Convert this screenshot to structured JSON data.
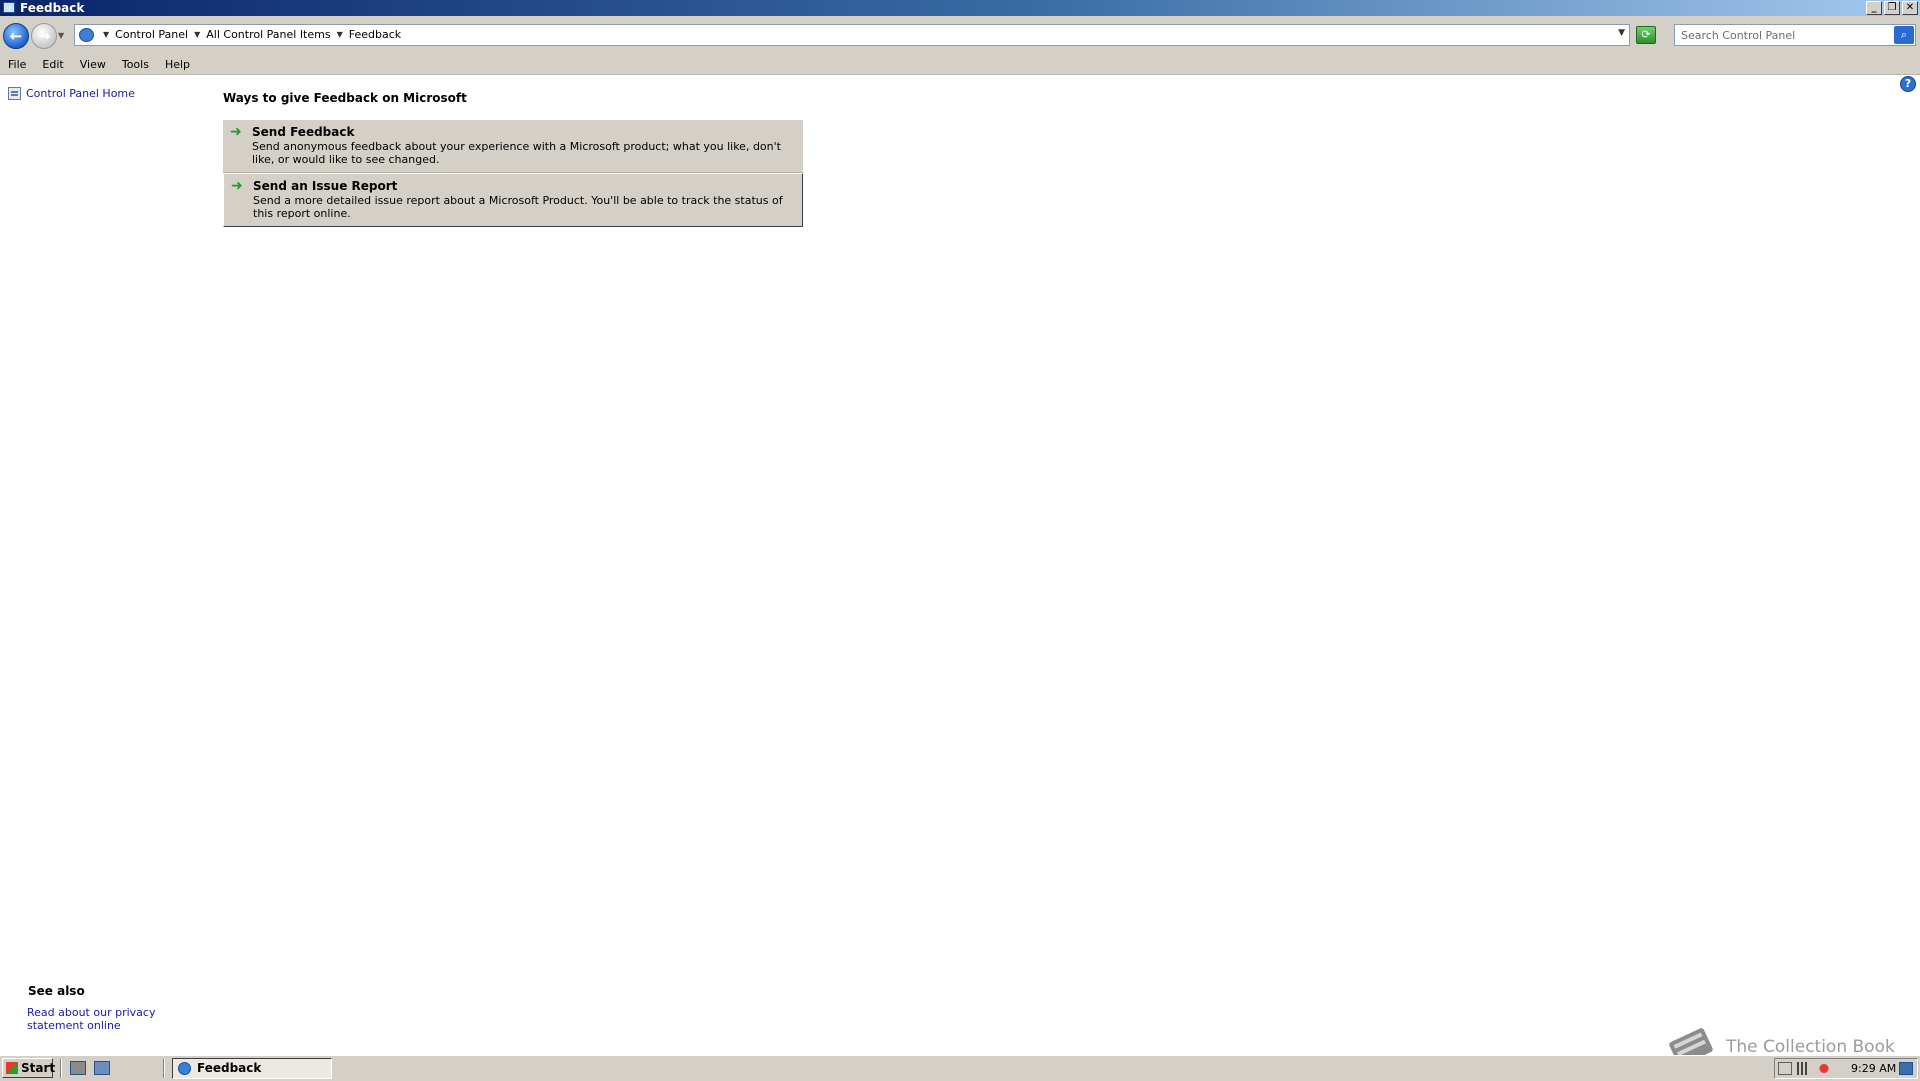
{
  "window": {
    "title": "Feedback"
  },
  "address_bar": {
    "breadcrumbs": [
      "Control Panel",
      "All Control Panel Items",
      "Feedback"
    ],
    "search_placeholder": "Search Control Panel"
  },
  "menu": [
    "File",
    "Edit",
    "View",
    "Tools",
    "Help"
  ],
  "left_pane": {
    "home_link": "Control Panel Home",
    "see_also_title": "See also",
    "see_also_link": "Read about our privacy statement online"
  },
  "main": {
    "heading": "Ways to give Feedback on Microsoft",
    "tasks": [
      {
        "title": "Send Feedback",
        "description": "Send anonymous feedback about your experience with a Microsoft product; what you like, don't like, or would like to see changed."
      },
      {
        "title": "Send an Issue Report",
        "description": "Send a more detailed issue report about a Microsoft Product.  You'll be able to track the status of this report online."
      }
    ]
  },
  "taskbar": {
    "start_label": "Start",
    "active_window": "Feedback",
    "clock": "9:29 AM"
  },
  "watermark": "The Collection Book",
  "icons": {
    "back": "back-arrow-icon",
    "forward": "forward-arrow-icon",
    "refresh": "refresh-icon",
    "search": "search-icon",
    "help": "help-icon",
    "task_arrow": "green-arrow-icon"
  },
  "colors": {
    "link": "#1a1aa6",
    "chrome": "#d4d0c8",
    "title_bar": "#0a246a",
    "task_arrow": "#1e9c1e"
  }
}
